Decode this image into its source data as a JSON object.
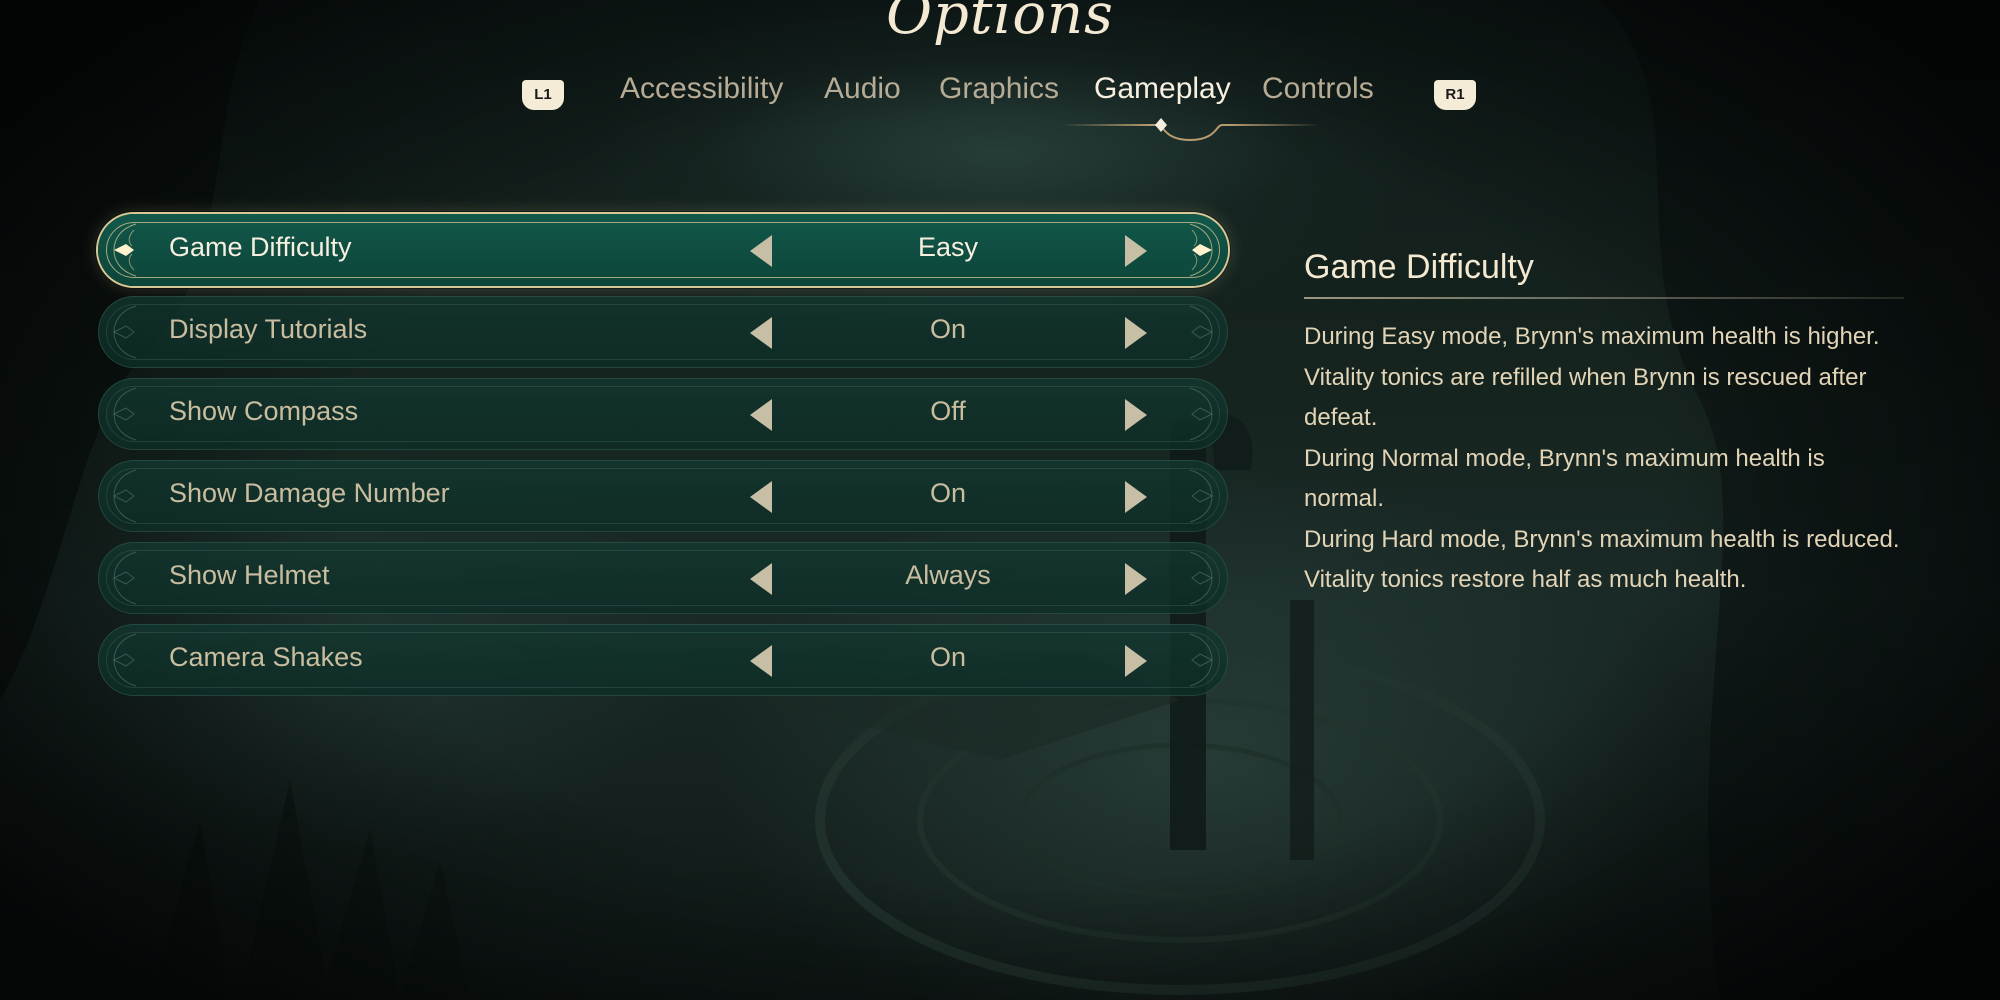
{
  "header": {
    "title": "Options"
  },
  "tabs": {
    "prev_button": "L1",
    "next_button": "R1",
    "items": [
      {
        "label": "Accessibility",
        "active": false
      },
      {
        "label": "Audio",
        "active": false
      },
      {
        "label": "Graphics",
        "active": false
      },
      {
        "label": "Gameplay",
        "active": true
      },
      {
        "label": "Controls",
        "active": false
      }
    ]
  },
  "settings": [
    {
      "label": "Game Difficulty",
      "value": "Easy",
      "selected": true
    },
    {
      "label": "Display Tutorials",
      "value": "On",
      "selected": false
    },
    {
      "label": "Show Compass",
      "value": "Off",
      "selected": false
    },
    {
      "label": "Show Damage Number",
      "value": "On",
      "selected": false
    },
    {
      "label": "Show Helmet",
      "value": "Always",
      "selected": false
    },
    {
      "label": "Camera Shakes",
      "value": "On",
      "selected": false
    }
  ],
  "description": {
    "title": "Game Difficulty",
    "paragraphs": [
      "During Easy mode, Brynn's maximum health is higher. Vitality tonics are refilled when Brynn is rescued after defeat.",
      "During Normal mode, Brynn's maximum health is normal.",
      "During Hard mode, Brynn's maximum health is reduced. Vitality tonics restore half as much health."
    ]
  },
  "icons": {
    "arrow_left": "caret-left-icon",
    "arrow_right": "caret-right-icon",
    "selection_marker": "diamond-marker-icon"
  },
  "colors": {
    "accent_gold": "#d8c797",
    "row_selected": "#0f4d41",
    "row_idle": "#0e2c26",
    "text_primary": "#f7f0e0",
    "text_muted": "#b6ab94"
  }
}
